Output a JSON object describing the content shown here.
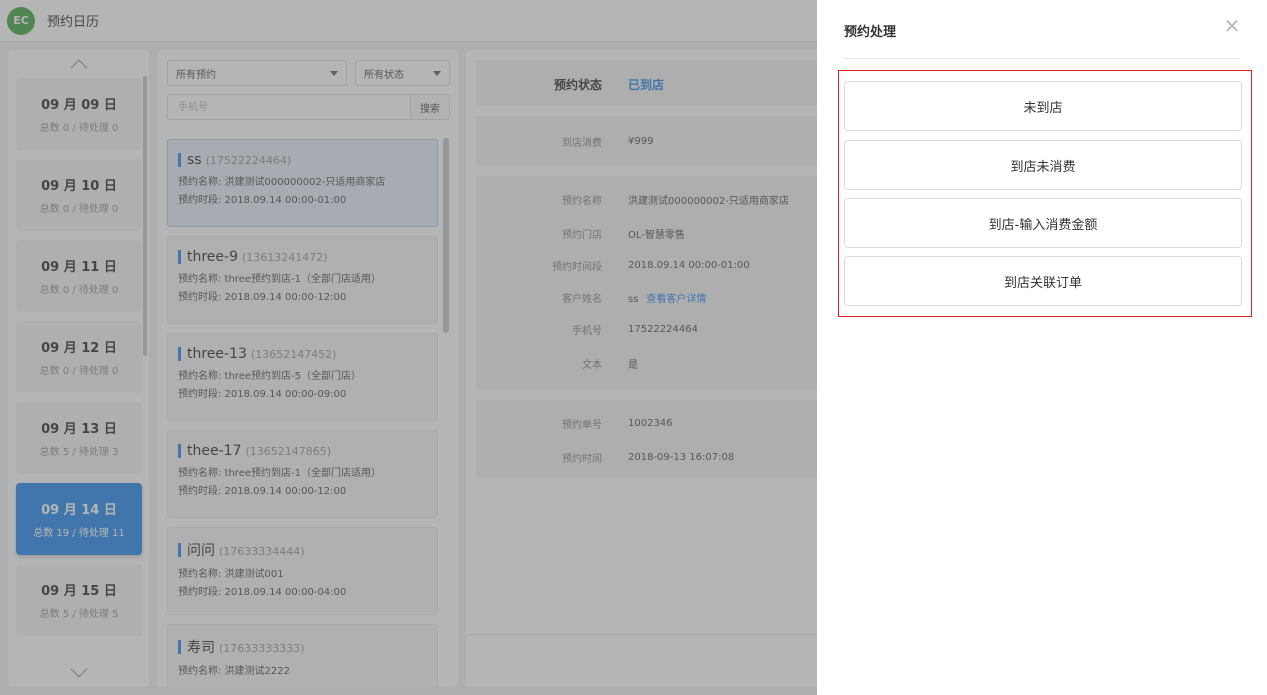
{
  "app": {
    "logo_text": "EC",
    "title": "预约日历"
  },
  "dates": [
    {
      "date": "09 月 09 日",
      "count": "总数 0 / 待处理 0",
      "active": false
    },
    {
      "date": "09 月 10 日",
      "count": "总数 0 / 待处理 0",
      "active": false
    },
    {
      "date": "09 月 11 日",
      "count": "总数 0 / 待处理 0",
      "active": false
    },
    {
      "date": "09 月 12 日",
      "count": "总数 0 / 待处理 0",
      "active": false
    },
    {
      "date": "09 月 13 日",
      "count": "总数 5 / 待处理 3",
      "active": false
    },
    {
      "date": "09 月 14 日",
      "count": "总数 19 / 待处理 11",
      "active": true
    },
    {
      "date": "09 月 15 日",
      "count": "总数 5 / 待处理 5",
      "active": false
    }
  ],
  "filters": {
    "type_select": "所有预约",
    "status_select": "所有状态",
    "phone_placeholder": "手机号",
    "search_label": "搜索"
  },
  "appointments": [
    {
      "name": "ss",
      "phone": "(17522224464)",
      "line1": "预约名称: 洪建测试000000002-只适用商家店",
      "line2": "预约时段: 2018.09.14 00:00-01:00"
    },
    {
      "name": "three-9",
      "phone": "(13613241472)",
      "line1": "预约名称: three预约到店-1（全部门店适用）",
      "line2": "预约时段: 2018.09.14 00:00-12:00"
    },
    {
      "name": "three-13",
      "phone": "(13652147452)",
      "line1": "预约名称: three预约到店-5（全部门店）",
      "line2": "预约时段: 2018.09.14 00:00-09:00"
    },
    {
      "name": "thee-17",
      "phone": "(13652147865)",
      "line1": "预约名称: three预约到店-1（全部门店适用）",
      "line2": "预约时段: 2018.09.14 00:00-12:00"
    },
    {
      "name": "问问",
      "phone": "(17633334444)",
      "line1": "预约名称: 洪建测试001",
      "line2": "预约时段: 2018.09.14 00:00-04:00"
    },
    {
      "name": "寿司",
      "phone": "(17633333333)",
      "line1": "预约名称: 洪建测试2222",
      "line2": ""
    }
  ],
  "detail": {
    "status_label": "预约状态",
    "status_value": "已到店",
    "spend_label": "到店消费",
    "spend_value": "¥999",
    "name_label": "预约名称",
    "name_value": "洪建测试000000002-只适用商家店",
    "store_label": "预约门店",
    "store_value": "OL-智慧零售",
    "period_label": "预约时间段",
    "period_value": "2018.09.14 00:00-01:00",
    "customer_label": "客户姓名",
    "customer_value": "ss",
    "customer_link": "查看客户详情",
    "phone_label": "手机号",
    "phone_value": "17522224464",
    "text_label": "文本",
    "text_value": "是",
    "order_label": "预约单号",
    "order_value": "1002346",
    "time_label": "预约时间",
    "time_value": "2018-09-13 16:07:08"
  },
  "drawer": {
    "title": "预约处理",
    "close_glyph": "✕",
    "actions": [
      "未到店",
      "到店未消费",
      "到店-输入消费金额",
      "到店关联订单"
    ]
  },
  "colors": {
    "accent": "#2d8cf0",
    "highlight_border": "#e02020",
    "logo": "#4aa84e"
  }
}
